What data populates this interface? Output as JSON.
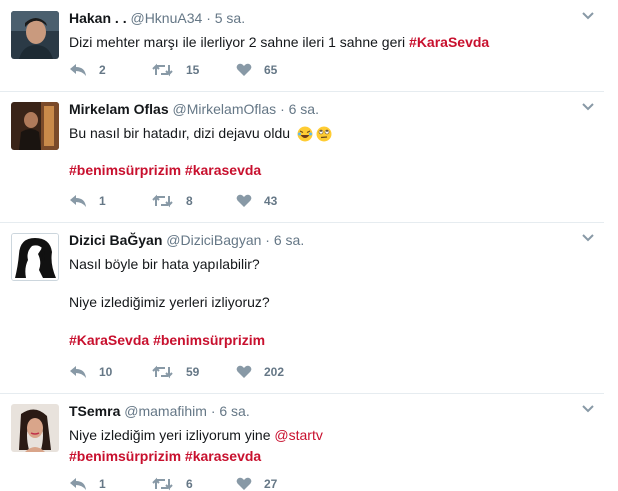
{
  "tweets": [
    {
      "name": "Hakan . .",
      "handle": "@HknuA34",
      "time": "5 sa.",
      "lines": [
        [
          {
            "t": "text",
            "v": "Dizi mehter marşı ile ilerliyor  2 sahne ileri 1 sahne geri "
          },
          {
            "t": "tag",
            "v": "#KaraSevda"
          }
        ]
      ],
      "replies": "2",
      "retweets": "15",
      "likes": "65"
    },
    {
      "name": "Mirkelam Oflas",
      "handle": "@MirkelamOflas",
      "time": "6 sa.",
      "lines": [
        [
          {
            "t": "text",
            "v": "Bu nasıl bir hatadır, dizi dejavu oldu"
          }
        ],
        [
          {
            "t": "tag",
            "v": "#benimsürprizim"
          },
          {
            "t": "text",
            "v": " "
          },
          {
            "t": "tag",
            "v": "#karasevda"
          }
        ]
      ],
      "replies": "1",
      "retweets": "8",
      "likes": "43"
    },
    {
      "name": "Dizici BaĞyan",
      "handle": "@DiziciBagyan",
      "time": "6 sa.",
      "lines": [
        [
          {
            "t": "text",
            "v": "Nasıl böyle bir hata yapılabilir?"
          }
        ],
        [
          {
            "t": "text",
            "v": "Niye izlediğimiz yerleri izliyoruz?"
          }
        ],
        [
          {
            "t": "tag",
            "v": "#KaraSevda"
          },
          {
            "t": "text",
            "v": " "
          },
          {
            "t": "tag",
            "v": "#benimsürprizim"
          }
        ]
      ],
      "replies": "10",
      "retweets": "59",
      "likes": "202"
    },
    {
      "name": "TSemra",
      "handle": "@mamafihim",
      "time": "6 sa.",
      "lines": [
        [
          {
            "t": "text",
            "v": "Niye izlediğim yeri izliyorum yine "
          },
          {
            "t": "mention",
            "v": "@startv"
          }
        ],
        [
          {
            "t": "tag",
            "v": "#benimsürprizim"
          },
          {
            "t": "text",
            "v": " "
          },
          {
            "t": "tag",
            "v": "#karasevda"
          }
        ]
      ],
      "replies": "1",
      "retweets": "6",
      "likes": "27"
    }
  ]
}
